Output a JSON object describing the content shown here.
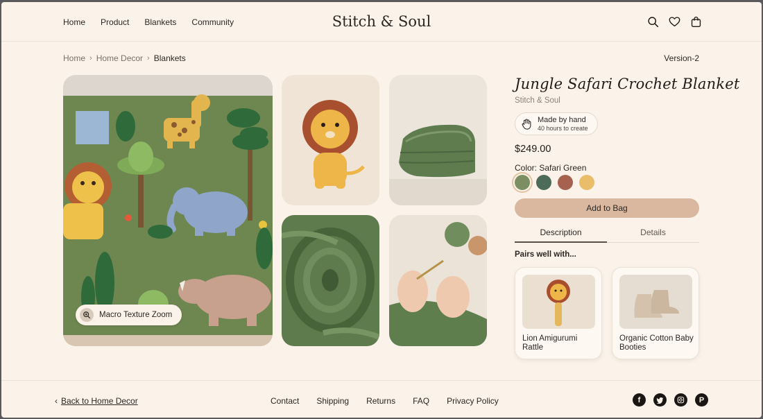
{
  "header": {
    "nav": [
      "Home",
      "Product",
      "Blankets",
      "Community"
    ],
    "brand": "Stitch & Soul",
    "icons": [
      "search-icon",
      "heart-icon",
      "bag-icon"
    ]
  },
  "breadcrumb": {
    "items": [
      "Home",
      "Home Decor",
      "Blankets"
    ]
  },
  "version": "Version-2",
  "gallery": {
    "zoom_label": "Macro Texture Zoom",
    "images": [
      "jungle-blanket-main",
      "lion-amigurumi",
      "folded-blanket",
      "blanket-texture-swirl",
      "hands-crocheting"
    ]
  },
  "product": {
    "title": "Jungle Safari Crochet Blanket",
    "maker": "Stitch & Soul",
    "badge_line1": "Made by hand",
    "badge_line2": "40 hours to create",
    "price": "$249.00",
    "color_label": "Color: Safari Green",
    "swatches": [
      "#7c8f62",
      "#4d6b59",
      "#a6614f",
      "#e9bd6a"
    ],
    "add_to_bag": "Add to Bag",
    "tabs": [
      "Description",
      "Details"
    ],
    "active_tab": "Description",
    "pairs_label": "Pairs well with...",
    "pairs": [
      {
        "name": "Lion Amigurumi Rattle"
      },
      {
        "name": "Organic Cotton Baby Booties"
      }
    ]
  },
  "footer": {
    "back": "Back to Home Decor",
    "links": [
      "Contact",
      "Shipping",
      "Returns",
      "FAQ",
      "Privacy Policy"
    ],
    "social": [
      "facebook-icon",
      "twitter-icon",
      "instagram-icon",
      "pinterest-icon"
    ]
  },
  "colors": {
    "background": "#fbf3ea",
    "accent": "#dab8a0",
    "text": "#2b2622"
  }
}
